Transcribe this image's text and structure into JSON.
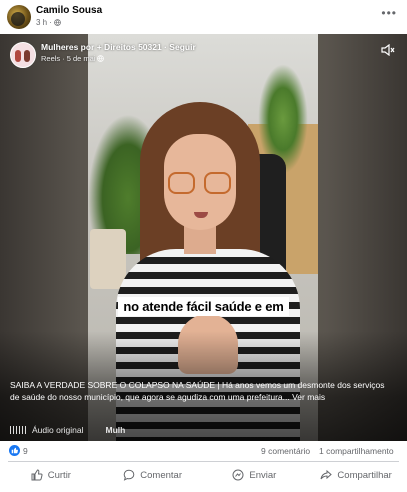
{
  "post": {
    "author": "Camilo Sousa",
    "time": "3 h",
    "more_label": "•••"
  },
  "video": {
    "group_name": "Mulheres por + Direitos 50321",
    "follow_label": "Seguir",
    "separator": "·",
    "kind": "Reels",
    "date": "5 de mai",
    "caption": "no atende fácil saúde e em",
    "description": "SAIBA A VERDADE SOBRE O COLAPSO NA SAÚDE | Há anos vemos um desmonte dos serviços de saúde do nosso município, que agora se agudiza com uma prefeitura... Ver mais",
    "audio_label": "Áudio original",
    "audio_next": "Mulh"
  },
  "stats": {
    "likes": "9",
    "comments": "9 comentário",
    "shares": "1 compartilhamento"
  },
  "actions": {
    "like": "Curtir",
    "comment": "Comentar",
    "send": "Enviar",
    "share": "Compartilhar"
  },
  "colors": {
    "accent": "#1877f2",
    "muted_text": "#65676b",
    "glasses": "#c46a2e"
  },
  "icons": [
    "globe-icon",
    "more-icon",
    "mute-icon",
    "like-icon",
    "comment-icon",
    "send-icon",
    "share-icon"
  ]
}
